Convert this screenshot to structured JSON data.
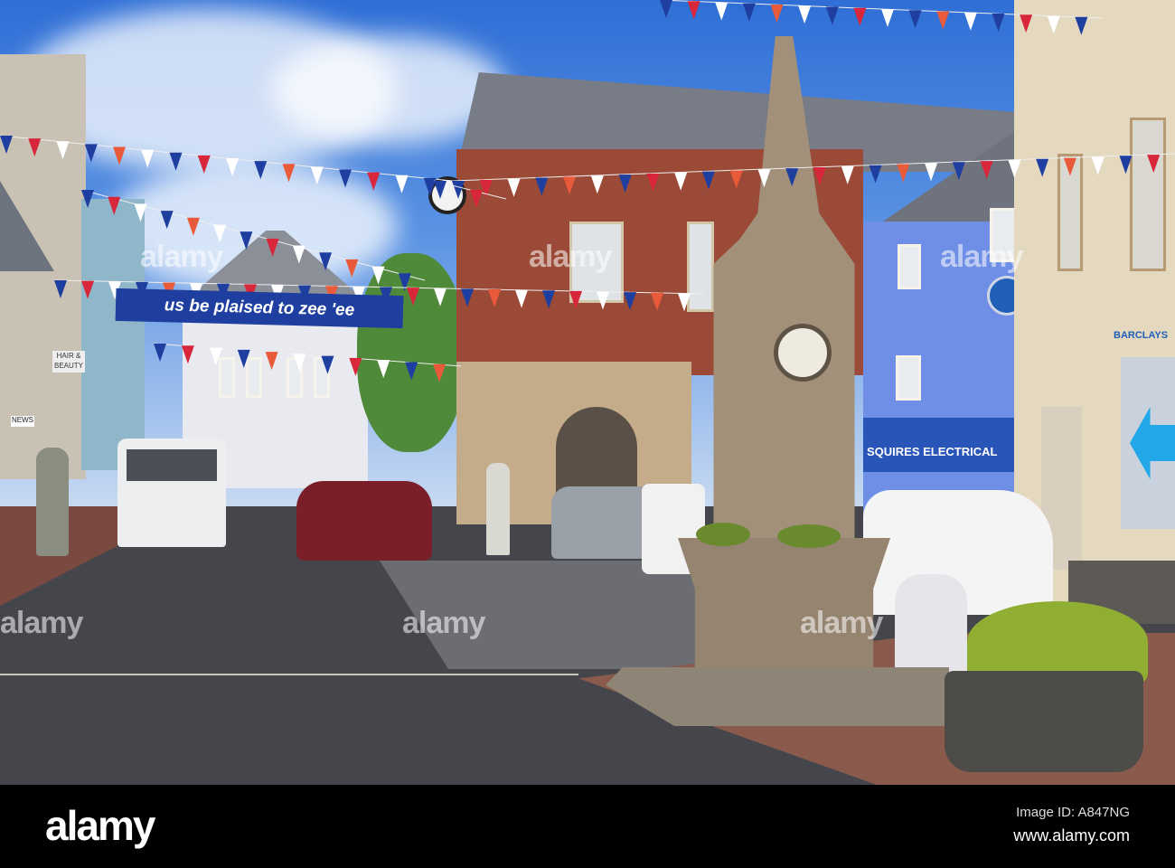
{
  "banner": {
    "text": "us be plaised to zee 'ee"
  },
  "signs": {
    "shop_awning": "SQUIRES ELECTRICAL",
    "bank": "BARCLAYS",
    "hair_salon": "HAIR & BEAUTY",
    "newsagent": "NEWS"
  },
  "watermark": {
    "text": "alamy"
  },
  "footer": {
    "logo": "alamy",
    "image_id": "Image ID: A847NG",
    "url": "www.alamy.com"
  },
  "colors": {
    "bunting": [
      "#1f3fa0",
      "#d8263a",
      "#ffffff",
      "#1f3fa0",
      "#e85a3a",
      "#ffffff"
    ],
    "brick": "#9a4a36",
    "blue_building": "#6f8fe6",
    "road": "#3e4046"
  }
}
